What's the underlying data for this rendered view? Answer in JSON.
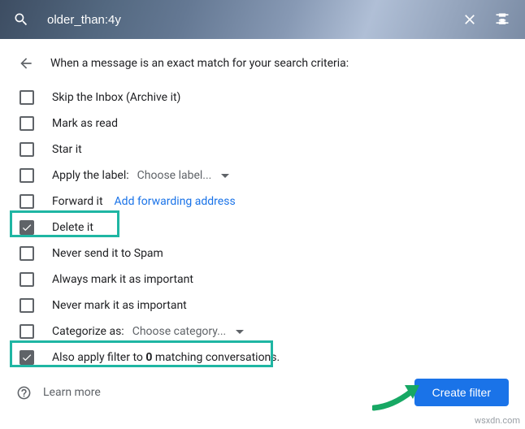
{
  "search": {
    "value": "older_than:4y"
  },
  "header": {
    "instruction": "When a message is an exact match for your search criteria:"
  },
  "options": {
    "skip_inbox": "Skip the Inbox (Archive it)",
    "mark_read": "Mark as read",
    "star": "Star it",
    "apply_label": "Apply the label:",
    "apply_label_dd": "Choose label...",
    "forward": "Forward it",
    "forward_link": "Add forwarding address",
    "delete": "Delete it",
    "never_spam": "Never send it to Spam",
    "always_important": "Always mark it as important",
    "never_important": "Never mark it as important",
    "categorize": "Categorize as:",
    "categorize_dd": "Choose category...",
    "also_apply_pre": "Also apply filter to ",
    "also_apply_count": "0",
    "also_apply_post": " matching conversations."
  },
  "footer": {
    "learn_more": "Learn more",
    "create_filter": "Create filter"
  },
  "watermark": "wsxdn.com"
}
